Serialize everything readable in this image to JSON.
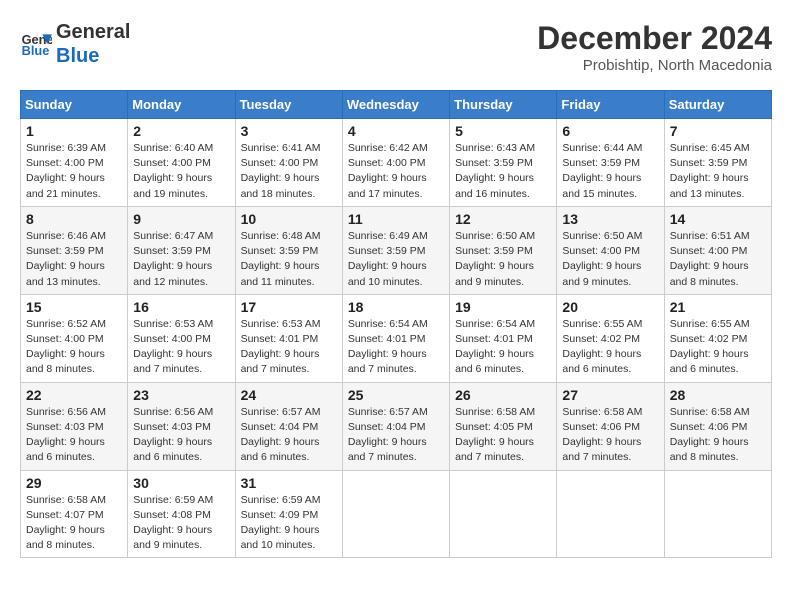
{
  "header": {
    "logo_general": "General",
    "logo_blue": "Blue",
    "month_title": "December 2024",
    "subtitle": "Probishtip, North Macedonia"
  },
  "days_of_week": [
    "Sunday",
    "Monday",
    "Tuesday",
    "Wednesday",
    "Thursday",
    "Friday",
    "Saturday"
  ],
  "weeks": [
    [
      {
        "day": "1",
        "sunrise": "6:39 AM",
        "sunset": "4:00 PM",
        "daylight": "9 hours and 21 minutes."
      },
      {
        "day": "2",
        "sunrise": "6:40 AM",
        "sunset": "4:00 PM",
        "daylight": "9 hours and 19 minutes."
      },
      {
        "day": "3",
        "sunrise": "6:41 AM",
        "sunset": "4:00 PM",
        "daylight": "9 hours and 18 minutes."
      },
      {
        "day": "4",
        "sunrise": "6:42 AM",
        "sunset": "4:00 PM",
        "daylight": "9 hours and 17 minutes."
      },
      {
        "day": "5",
        "sunrise": "6:43 AM",
        "sunset": "3:59 PM",
        "daylight": "9 hours and 16 minutes."
      },
      {
        "day": "6",
        "sunrise": "6:44 AM",
        "sunset": "3:59 PM",
        "daylight": "9 hours and 15 minutes."
      },
      {
        "day": "7",
        "sunrise": "6:45 AM",
        "sunset": "3:59 PM",
        "daylight": "9 hours and 13 minutes."
      }
    ],
    [
      {
        "day": "8",
        "sunrise": "6:46 AM",
        "sunset": "3:59 PM",
        "daylight": "9 hours and 13 minutes."
      },
      {
        "day": "9",
        "sunrise": "6:47 AM",
        "sunset": "3:59 PM",
        "daylight": "9 hours and 12 minutes."
      },
      {
        "day": "10",
        "sunrise": "6:48 AM",
        "sunset": "3:59 PM",
        "daylight": "9 hours and 11 minutes."
      },
      {
        "day": "11",
        "sunrise": "6:49 AM",
        "sunset": "3:59 PM",
        "daylight": "9 hours and 10 minutes."
      },
      {
        "day": "12",
        "sunrise": "6:50 AM",
        "sunset": "3:59 PM",
        "daylight": "9 hours and 9 minutes."
      },
      {
        "day": "13",
        "sunrise": "6:50 AM",
        "sunset": "4:00 PM",
        "daylight": "9 hours and 9 minutes."
      },
      {
        "day": "14",
        "sunrise": "6:51 AM",
        "sunset": "4:00 PM",
        "daylight": "9 hours and 8 minutes."
      }
    ],
    [
      {
        "day": "15",
        "sunrise": "6:52 AM",
        "sunset": "4:00 PM",
        "daylight": "9 hours and 8 minutes."
      },
      {
        "day": "16",
        "sunrise": "6:53 AM",
        "sunset": "4:00 PM",
        "daylight": "9 hours and 7 minutes."
      },
      {
        "day": "17",
        "sunrise": "6:53 AM",
        "sunset": "4:01 PM",
        "daylight": "9 hours and 7 minutes."
      },
      {
        "day": "18",
        "sunrise": "6:54 AM",
        "sunset": "4:01 PM",
        "daylight": "9 hours and 7 minutes."
      },
      {
        "day": "19",
        "sunrise": "6:54 AM",
        "sunset": "4:01 PM",
        "daylight": "9 hours and 6 minutes."
      },
      {
        "day": "20",
        "sunrise": "6:55 AM",
        "sunset": "4:02 PM",
        "daylight": "9 hours and 6 minutes."
      },
      {
        "day": "21",
        "sunrise": "6:55 AM",
        "sunset": "4:02 PM",
        "daylight": "9 hours and 6 minutes."
      }
    ],
    [
      {
        "day": "22",
        "sunrise": "6:56 AM",
        "sunset": "4:03 PM",
        "daylight": "9 hours and 6 minutes."
      },
      {
        "day": "23",
        "sunrise": "6:56 AM",
        "sunset": "4:03 PM",
        "daylight": "9 hours and 6 minutes."
      },
      {
        "day": "24",
        "sunrise": "6:57 AM",
        "sunset": "4:04 PM",
        "daylight": "9 hours and 6 minutes."
      },
      {
        "day": "25",
        "sunrise": "6:57 AM",
        "sunset": "4:04 PM",
        "daylight": "9 hours and 7 minutes."
      },
      {
        "day": "26",
        "sunrise": "6:58 AM",
        "sunset": "4:05 PM",
        "daylight": "9 hours and 7 minutes."
      },
      {
        "day": "27",
        "sunrise": "6:58 AM",
        "sunset": "4:06 PM",
        "daylight": "9 hours and 7 minutes."
      },
      {
        "day": "28",
        "sunrise": "6:58 AM",
        "sunset": "4:06 PM",
        "daylight": "9 hours and 8 minutes."
      }
    ],
    [
      {
        "day": "29",
        "sunrise": "6:58 AM",
        "sunset": "4:07 PM",
        "daylight": "9 hours and 8 minutes."
      },
      {
        "day": "30",
        "sunrise": "6:59 AM",
        "sunset": "4:08 PM",
        "daylight": "9 hours and 9 minutes."
      },
      {
        "day": "31",
        "sunrise": "6:59 AM",
        "sunset": "4:09 PM",
        "daylight": "9 hours and 10 minutes."
      },
      null,
      null,
      null,
      null
    ]
  ],
  "labels": {
    "sunrise": "Sunrise:",
    "sunset": "Sunset:",
    "daylight": "Daylight:"
  }
}
